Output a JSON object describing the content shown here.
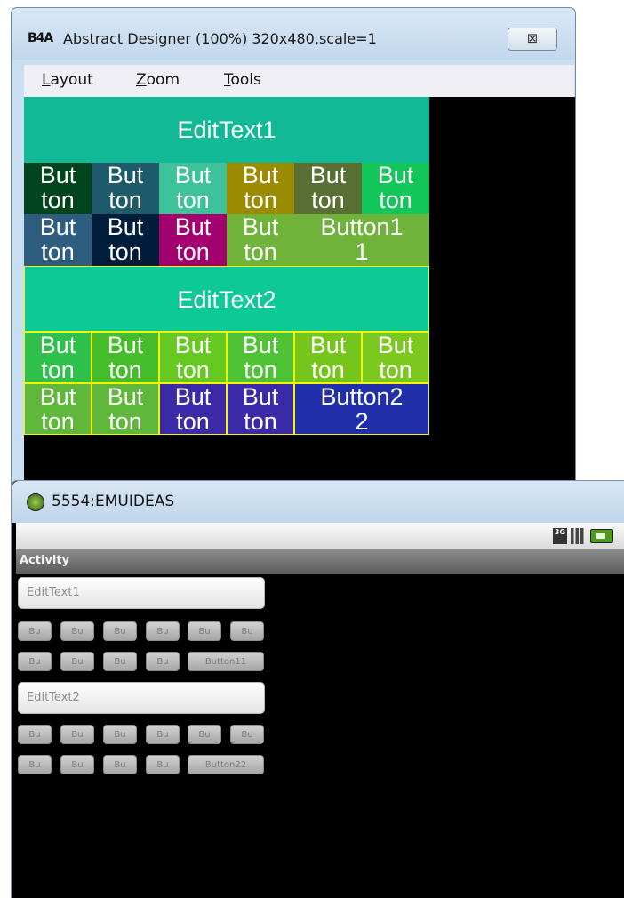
{
  "designer": {
    "logo": "B4A",
    "title": "Abstract Designer (100%) 320x480,scale=1",
    "close_symbol": "⊠",
    "menu": [
      {
        "label": "Layout",
        "mnemonic_index": 0
      },
      {
        "label": "Zoom",
        "mnemonic_index": 0
      },
      {
        "label": "Tools",
        "mnemonic_index": 0
      }
    ],
    "edittext1": "EditText1",
    "edittext2": "EditText2",
    "row1": [
      {
        "line1": "But",
        "line2": "ton",
        "color": "#00451d"
      },
      {
        "line1": "But",
        "line2": "ton",
        "color": "#1d5a6a"
      },
      {
        "line1": "But",
        "line2": "ton",
        "color": "#3dc29a"
      },
      {
        "line1": "But",
        "line2": "ton",
        "color": "#9b8b00"
      },
      {
        "line1": "But",
        "line2": "ton",
        "color": "#5a6f33"
      },
      {
        "line1": "But",
        "line2": "ton",
        "color": "#13c65a"
      }
    ],
    "row2": [
      {
        "line1": "But",
        "line2": "ton",
        "color": "#2e5d7f"
      },
      {
        "line1": "But",
        "line2": "ton",
        "color": "#001e3c"
      },
      {
        "line1": "But",
        "line2": "ton",
        "color": "#a3006f"
      },
      {
        "line1": "But",
        "line2": "ton",
        "color": "#6fb33b"
      },
      {
        "line1": "Button1",
        "line2": "1",
        "color": "#6fb33b"
      }
    ],
    "row3": [
      {
        "line1": "But",
        "line2": "ton",
        "color": "#2ec04b"
      },
      {
        "line1": "But",
        "line2": "ton",
        "color": "#45bd2a"
      },
      {
        "line1": "But",
        "line2": "ton",
        "color": "#66c922"
      },
      {
        "line1": "But",
        "line2": "ton",
        "color": "#4fc235"
      },
      {
        "line1": "But",
        "line2": "ton",
        "color": "#76c51c"
      },
      {
        "line1": "But",
        "line2": "ton",
        "color": "#7bc81f"
      }
    ],
    "row4": [
      {
        "line1": "But",
        "line2": "ton",
        "color": "#5fb83c"
      },
      {
        "line1": "But",
        "line2": "ton",
        "color": "#5fb83c"
      },
      {
        "line1": "But",
        "line2": "ton",
        "color": "#3a2aa8"
      },
      {
        "line1": "But",
        "line2": "ton",
        "color": "#3a2aa8"
      },
      {
        "line1": "Button2",
        "line2": "2",
        "color": "#2130a8"
      }
    ],
    "colors": {
      "edittext1_bg": "#12b996",
      "edittext2_bg": "#0dc996",
      "highlight_border": "#f5f500"
    }
  },
  "emulator": {
    "title": "5554:EMUIDEAS",
    "status_3g": "3G",
    "activity_title": "Activity",
    "edittext1": "EditText1",
    "edittext2": "EditText2",
    "row1": [
      "Bu",
      "Bu",
      "Bu",
      "Bu",
      "Bu",
      "Bu"
    ],
    "row2": [
      "Bu",
      "Bu",
      "Bu",
      "Bu",
      "Button11"
    ],
    "row3": [
      "Bu",
      "Bu",
      "Bu",
      "Bu",
      "Bu",
      "Bu"
    ],
    "row4": [
      "Bu",
      "Bu",
      "Bu",
      "Bu",
      "Button22"
    ]
  }
}
